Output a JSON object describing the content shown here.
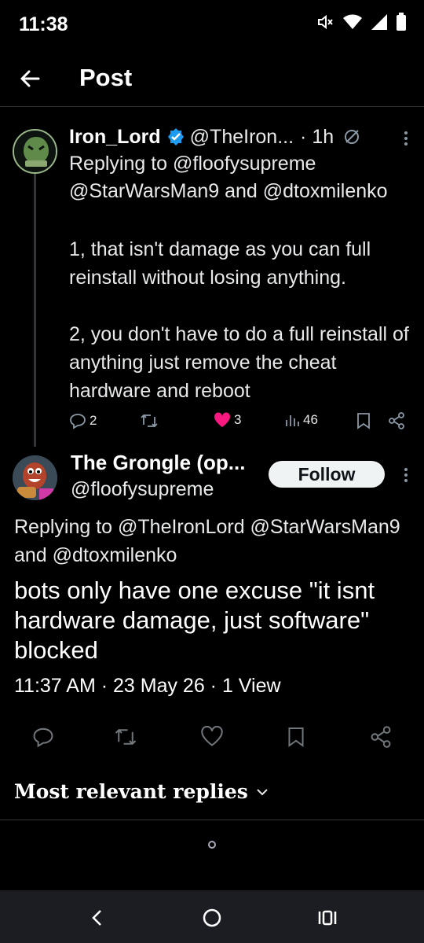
{
  "status_bar": {
    "time": "11:38",
    "icons": [
      "mute-icon",
      "wifi-icon",
      "signal-icon",
      "battery-icon"
    ]
  },
  "header": {
    "title": "Post",
    "back_icon": "arrow-left-icon"
  },
  "parent_post": {
    "author_name": "Iron_Lord",
    "verified": true,
    "handle": "@TheIron...",
    "time": "· 1h",
    "replying_to": "Replying to @floofysupreme @StarWarsMan9 and @dtoxmilenko",
    "body": "1, that isn't damage as you can full reinstall without losing anything.\n\n2, you don't have to do a full reinstall of anything just remove the cheat hardware and reboot",
    "stats": {
      "replies": "2",
      "reposts": "",
      "likes": "3",
      "views": "46"
    }
  },
  "main_post": {
    "author_name": "The Grongle (op...",
    "handle": "@floofysupreme",
    "follow_label": "Follow",
    "replying_to": "Replying to @TheIronLord @StarWarsMan9",
    "replying_to_line2": "and @dtoxmilenko",
    "body": "bots only have one excuse \"it isnt hardware damage, just software\" blocked",
    "meta": "11:37 AM · 23 May 26 · 1 View"
  },
  "replies_section": {
    "sort_label": "Most relevant replies"
  },
  "colors": {
    "background": "#000000",
    "text": "#e7e9ea",
    "verified_blue": "#1d9bf0",
    "like_pink": "#f91880",
    "divider": "#2f3336"
  }
}
